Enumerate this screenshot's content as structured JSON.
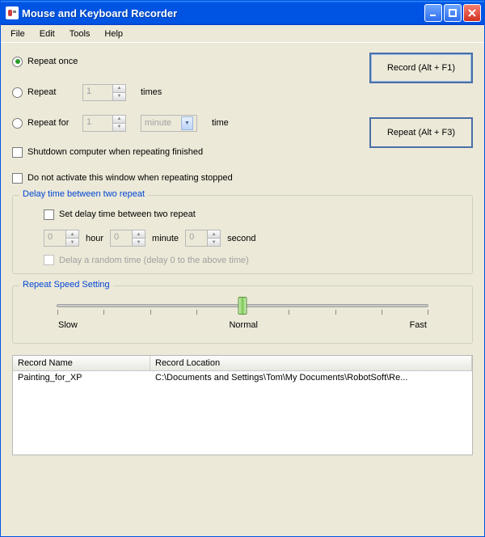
{
  "title": "Mouse and Keyboard Recorder",
  "menu": {
    "file": "File",
    "edit": "Edit",
    "tools": "Tools",
    "help": "Help"
  },
  "buttons": {
    "record": "Record (Alt + F1)",
    "repeat": "Repeat (Alt + F3)"
  },
  "repeat": {
    "once": "Repeat once",
    "n": "Repeat",
    "n_val": "1",
    "n_suffix": "times",
    "for": "Repeat for",
    "for_val": "1",
    "for_unit": "minute",
    "for_suffix": "time"
  },
  "opts": {
    "shutdown": "Shutdown computer when repeating finished",
    "noactivate": "Do not activate this window when repeating stopped"
  },
  "delay": {
    "title": "Delay time between two repeat",
    "set": "Set delay time between two repeat",
    "h": "0",
    "hl": "hour",
    "m": "0",
    "ml": "minute",
    "s": "0",
    "sl": "second",
    "random": "Delay a random time (delay 0 to the above time)"
  },
  "speed": {
    "title": "Repeat Speed Setting",
    "slow": "Slow",
    "normal": "Normal",
    "fast": "Fast"
  },
  "list": {
    "col1": "Record Name",
    "col2": "Record Location",
    "r1name": "Painting_for_XP",
    "r1loc": "C:\\Documents and Settings\\Tom\\My Documents\\RobotSoft\\Re..."
  }
}
